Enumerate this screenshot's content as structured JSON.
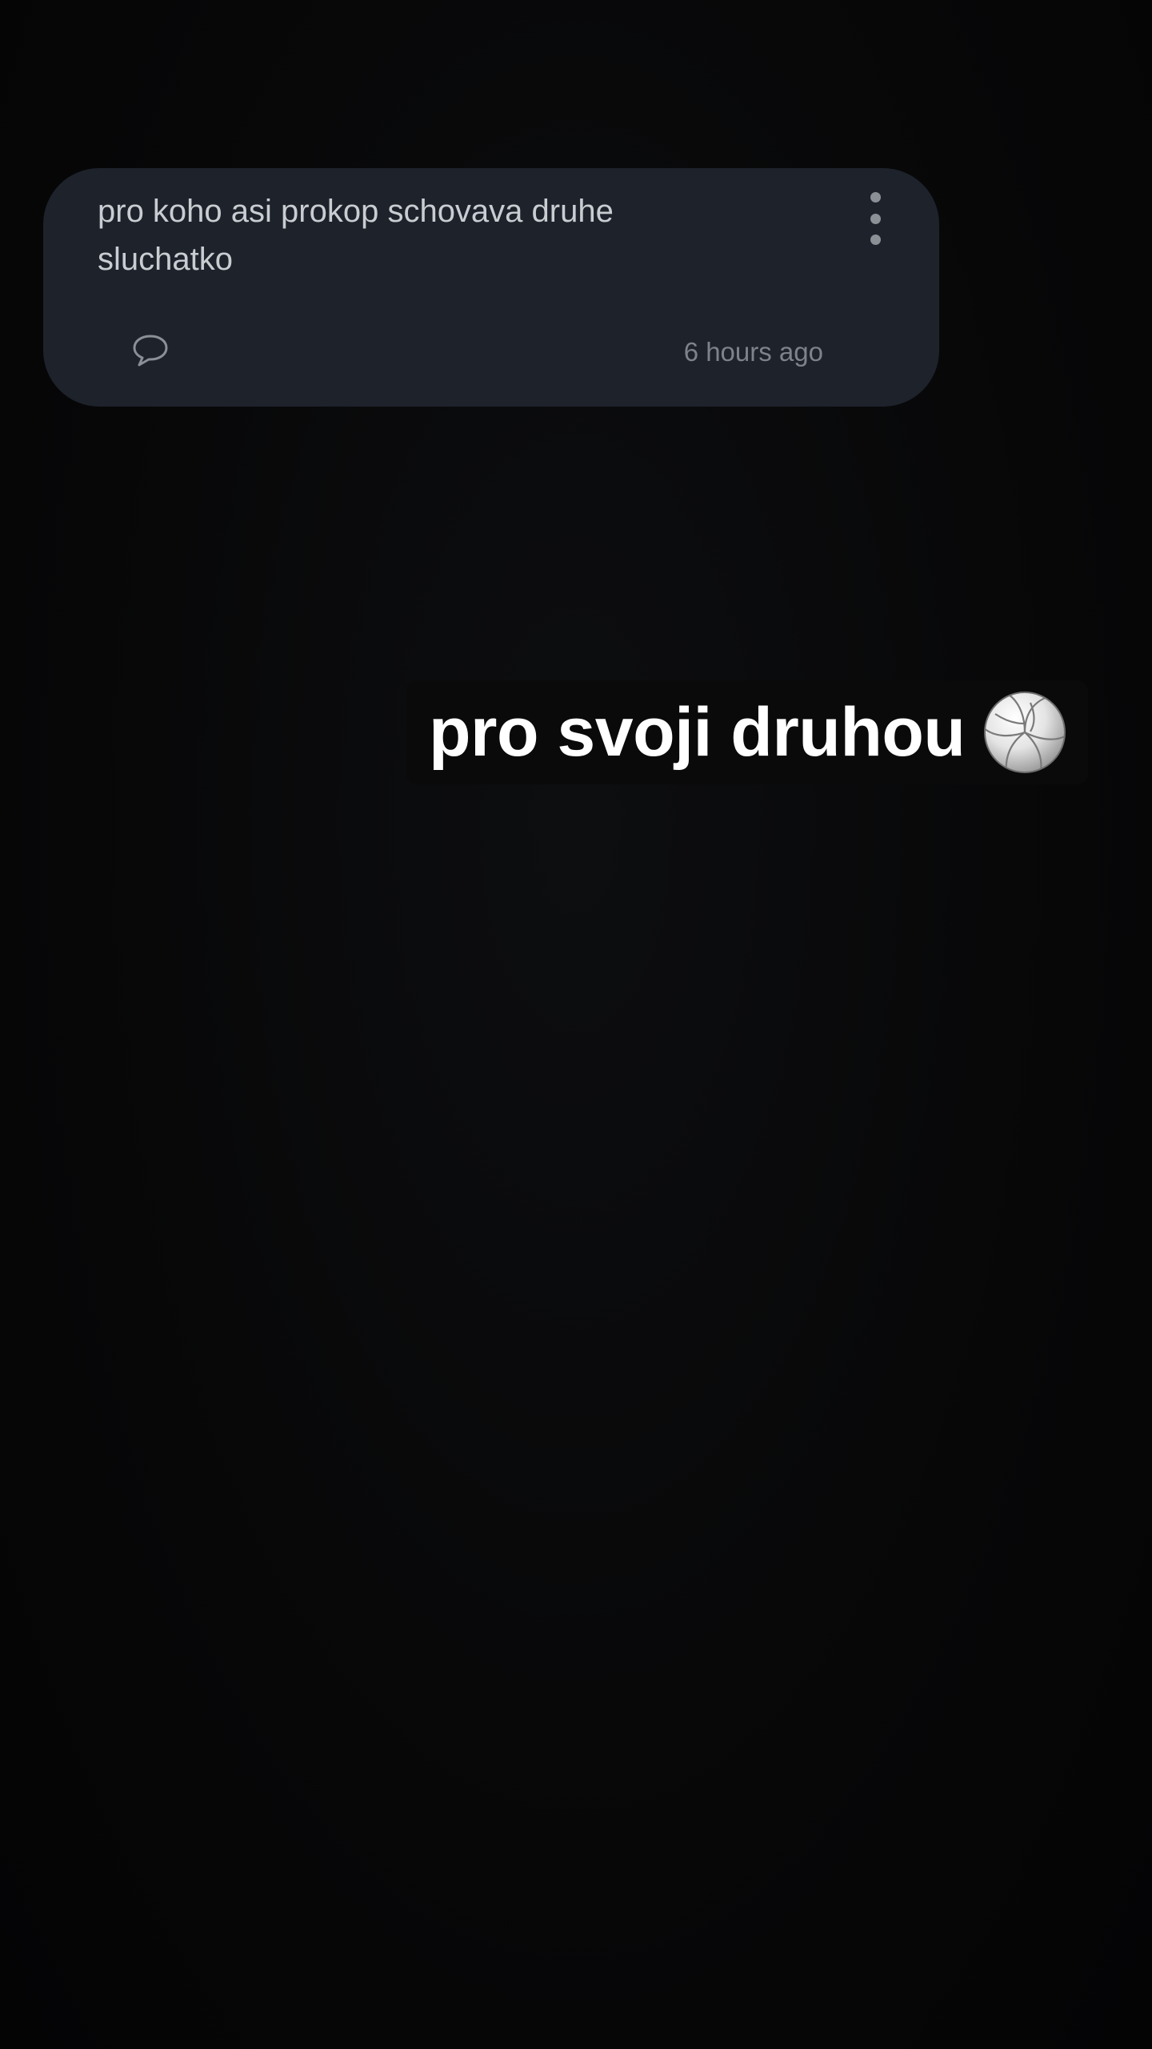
{
  "question_card": {
    "text": "pro koho asi prokop schovava druhe sluchatko",
    "timestamp": "6 hours ago",
    "icons": {
      "menu": "more-vertical-icon",
      "comment": "comment-bubble-icon"
    },
    "colors": {
      "card_background": "#1d222b",
      "text": "#c9ccd1",
      "muted": "#7e838a"
    }
  },
  "reply": {
    "text": "pro svoji druhou",
    "emoji": "volleyball-emoji",
    "colors": {
      "text": "#ffffff",
      "background": "#0a0a0b"
    }
  }
}
